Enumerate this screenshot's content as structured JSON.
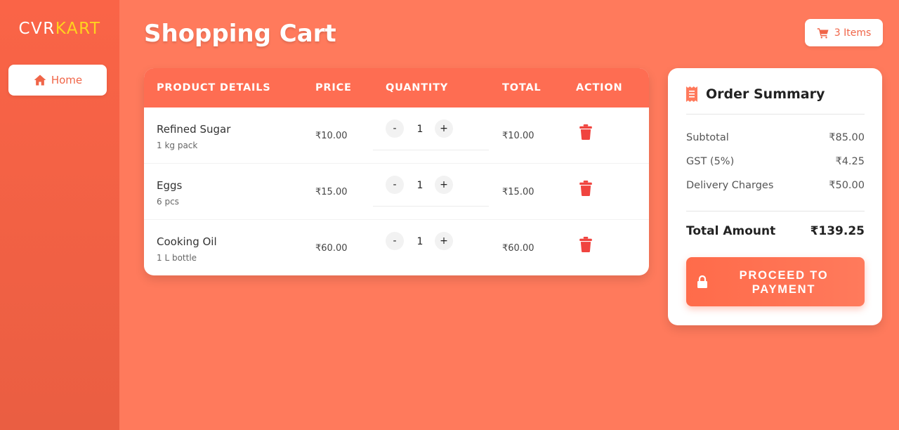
{
  "brand": {
    "part1": "CVR",
    "part2": "KART"
  },
  "sidebar": {
    "home_label": "Home"
  },
  "header": {
    "title": "Shopping Cart",
    "items_badge": "3 Items"
  },
  "cart": {
    "columns": [
      "PRODUCT DETAILS",
      "PRICE",
      "QUANTITY",
      "TOTAL",
      "ACTION"
    ],
    "rows": [
      {
        "name": "Refined Sugar",
        "detail": "1 kg pack",
        "price": "₹10.00",
        "quantity": "1",
        "total": "₹10.00"
      },
      {
        "name": "Eggs",
        "detail": "6 pcs",
        "price": "₹15.00",
        "quantity": "1",
        "total": "₹15.00"
      },
      {
        "name": "Cooking Oil",
        "detail": "1 L bottle",
        "price": "₹60.00",
        "quantity": "1",
        "total": "₹60.00"
      }
    ],
    "minus": "-",
    "plus": "+"
  },
  "summary": {
    "title": "Order Summary",
    "subtotal_label": "Subtotal",
    "subtotal": "₹85.00",
    "gst_label": "GST (5%)",
    "gst": "₹4.25",
    "delivery_label": "Delivery Charges",
    "delivery": "₹50.00",
    "total_label": "Total Amount",
    "total": "₹139.25",
    "pay_button": "PROCEED TO PAYMENT"
  },
  "colors": {
    "background": "#ff7a5c",
    "accent": "#fe6d52",
    "logo_highlight": "#ffd21f",
    "trash": "#f0443f"
  }
}
